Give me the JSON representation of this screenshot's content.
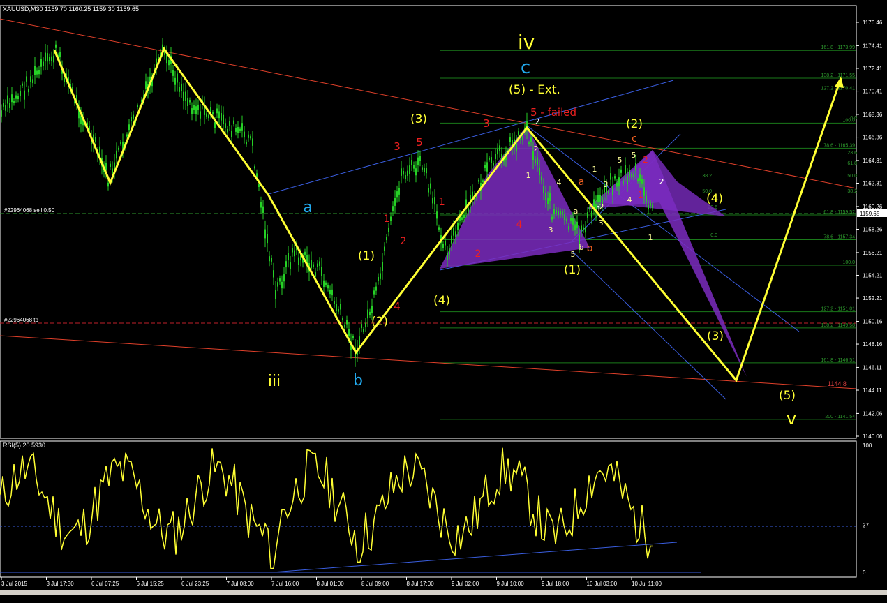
{
  "window": {
    "symbol_header": "XAUUSD,M30  1159.70 1160.25 1159.30 1159.65",
    "rsi_header": "RSI(5) 20.5930",
    "current_price": "1159.65",
    "target_price": "1144.8"
  },
  "order_lines": {
    "sell": "#22964068 sell 0.50",
    "tp": "#22964068 tp"
  },
  "chart_data": {
    "type": "candlestick",
    "price_ticks": [
      "1176.46",
      "1174.41",
      "1172.41",
      "1170.41",
      "1168.36",
      "1166.36",
      "1164.31",
      "1162.31",
      "1160.26",
      "1158.26",
      "1156.21",
      "1154.21",
      "1152.21",
      "1150.16",
      "1148.16",
      "1146.11",
      "1144.11",
      "1142.06",
      "1140.06"
    ],
    "rsi_ticks": [
      "100",
      "37",
      "0"
    ],
    "time_ticks": [
      "3 Jul 2015",
      "3 Jul 17:30",
      "6 Jul 07:25",
      "6 Jul 15:25",
      "6 Jul 23:25",
      "7 Jul 08:00",
      "7 Jul 16:00",
      "8 Jul 01:00",
      "8 Jul 09:00",
      "8 Jul 17:00",
      "9 Jul 02:00",
      "9 Jul 10:00",
      "9 Jul 18:00",
      "10 Jul 03:00",
      "10 Jul 11:00"
    ],
    "fib_levels": [
      {
        "label": "161.8 - 1173.99",
        "price": 1173.99
      },
      {
        "label": "138.2 - 1171.55",
        "price": 1171.55
      },
      {
        "label": "127.2 - 1170.41",
        "price": 1170.41
      },
      {
        "label": "100.0",
        "price": 1167.6
      },
      {
        "label": "78.6 - 1165.39",
        "price": 1165.39
      },
      {
        "label": "61.8 - 1159.52",
        "price": 1159.52
      },
      {
        "label": "78.6 - 1157.34",
        "price": 1157.34
      },
      {
        "label": "100.0",
        "price": 1155.1
      },
      {
        "label": "127.2 - 1151.01",
        "price": 1151.01
      },
      {
        "label": "138.2 - 1149.58",
        "price": 1149.58
      },
      {
        "label": "161.8 - 1146.51",
        "price": 1146.51
      },
      {
        "label": "200 - 1141.54",
        "price": 1141.54
      }
    ],
    "fib_small_labels": [
      "0.0",
      "23.6",
      "61.8",
      "50.0",
      "38.2",
      "23.6",
      "0.0",
      "38.2",
      "50.0"
    ],
    "wave_labels": {
      "yellow": [
        "iv",
        "(5) - Ext.",
        "(3)",
        "(2)",
        "(1)",
        "(2)",
        "(4)",
        "(1)",
        "(4)",
        "(3)",
        "(5)",
        "iii",
        "v"
      ],
      "blue": [
        "c",
        "a",
        "b"
      ],
      "red": [
        "5 - failed",
        "3",
        "5",
        "3",
        "c",
        "1",
        "1",
        "4",
        "2",
        "2",
        "4",
        "a",
        "b",
        "1",
        "2"
      ],
      "small": [
        "2",
        "1",
        "4",
        "3",
        "5",
        "a",
        "b",
        "5",
        "3",
        "2",
        "1",
        "2",
        "3",
        "4",
        "5",
        "1",
        "2",
        "1",
        "2"
      ]
    },
    "rsi_value": 20.593
  }
}
